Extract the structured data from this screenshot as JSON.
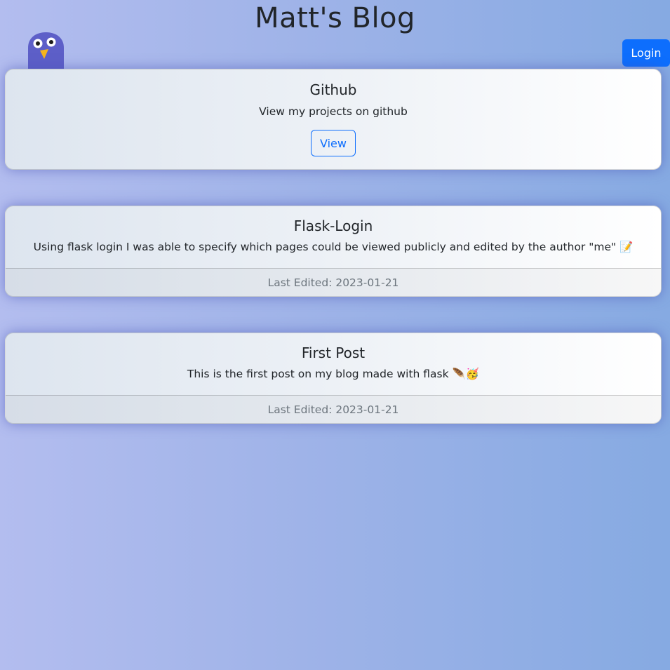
{
  "header": {
    "title": "Matt's Blog",
    "login_label": "Login"
  },
  "cards": {
    "github": {
      "title": "Github",
      "text": "View my projects on github",
      "button_label": "View"
    },
    "posts": [
      {
        "title": "Flask-Login",
        "text": "Using flask login I was able to specify which pages could be viewed publicly and edited by the author \"me\" 📝",
        "footer": "Last Edited: 2023-01-21"
      },
      {
        "title": "First Post",
        "text": "This is the first post on my blog made with flask 🪶🥳",
        "footer": "Last Edited: 2023-01-21"
      }
    ]
  },
  "colors": {
    "primary": "#0d6efd",
    "mascot_body": "#5d5fc8",
    "mascot_beak": "#f5b51c"
  },
  "icons": {
    "mascot": "owl-mascot-icon"
  }
}
